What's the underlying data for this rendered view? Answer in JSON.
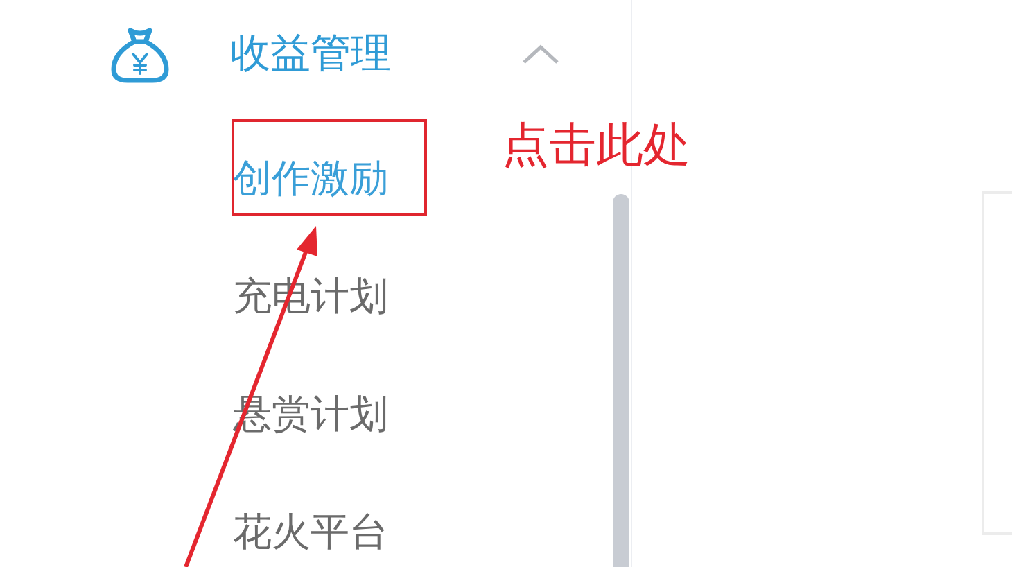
{
  "menu": {
    "title": "收益管理",
    "expanded": true,
    "items": [
      {
        "label": "创作激励",
        "selected": true
      },
      {
        "label": "充电计划",
        "selected": false
      },
      {
        "label": "悬赏计划",
        "selected": false
      },
      {
        "label": "花火平台",
        "selected": false
      }
    ]
  },
  "annotation": {
    "text": "点击此处"
  }
}
